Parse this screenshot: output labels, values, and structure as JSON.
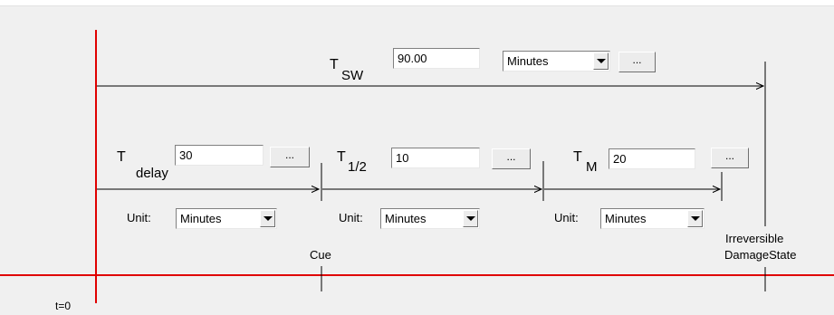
{
  "t_sw": {
    "symbol": "T",
    "subscript": "SW",
    "value": "90.00",
    "unit": "Minutes",
    "button": "..."
  },
  "t_delay": {
    "symbol": "T",
    "subscript": "delay",
    "value": "30",
    "button": "...",
    "unit_label": "Unit:",
    "unit": "Minutes"
  },
  "t_half": {
    "symbol": "T",
    "subscript": "1/2",
    "value": "10",
    "button": "...",
    "unit_label": "Unit:",
    "unit": "Minutes"
  },
  "t_m": {
    "symbol": "T",
    "subscript": "M",
    "value": "20",
    "button": "...",
    "unit_label": "Unit:",
    "unit": "Minutes"
  },
  "markers": {
    "cue": "Cue",
    "irreversible_line1": "Irreversible",
    "irreversible_line2": "DamageState",
    "origin": "t=0"
  },
  "colors": {
    "axis": "#e00000",
    "panel": "#f0f0f0"
  }
}
